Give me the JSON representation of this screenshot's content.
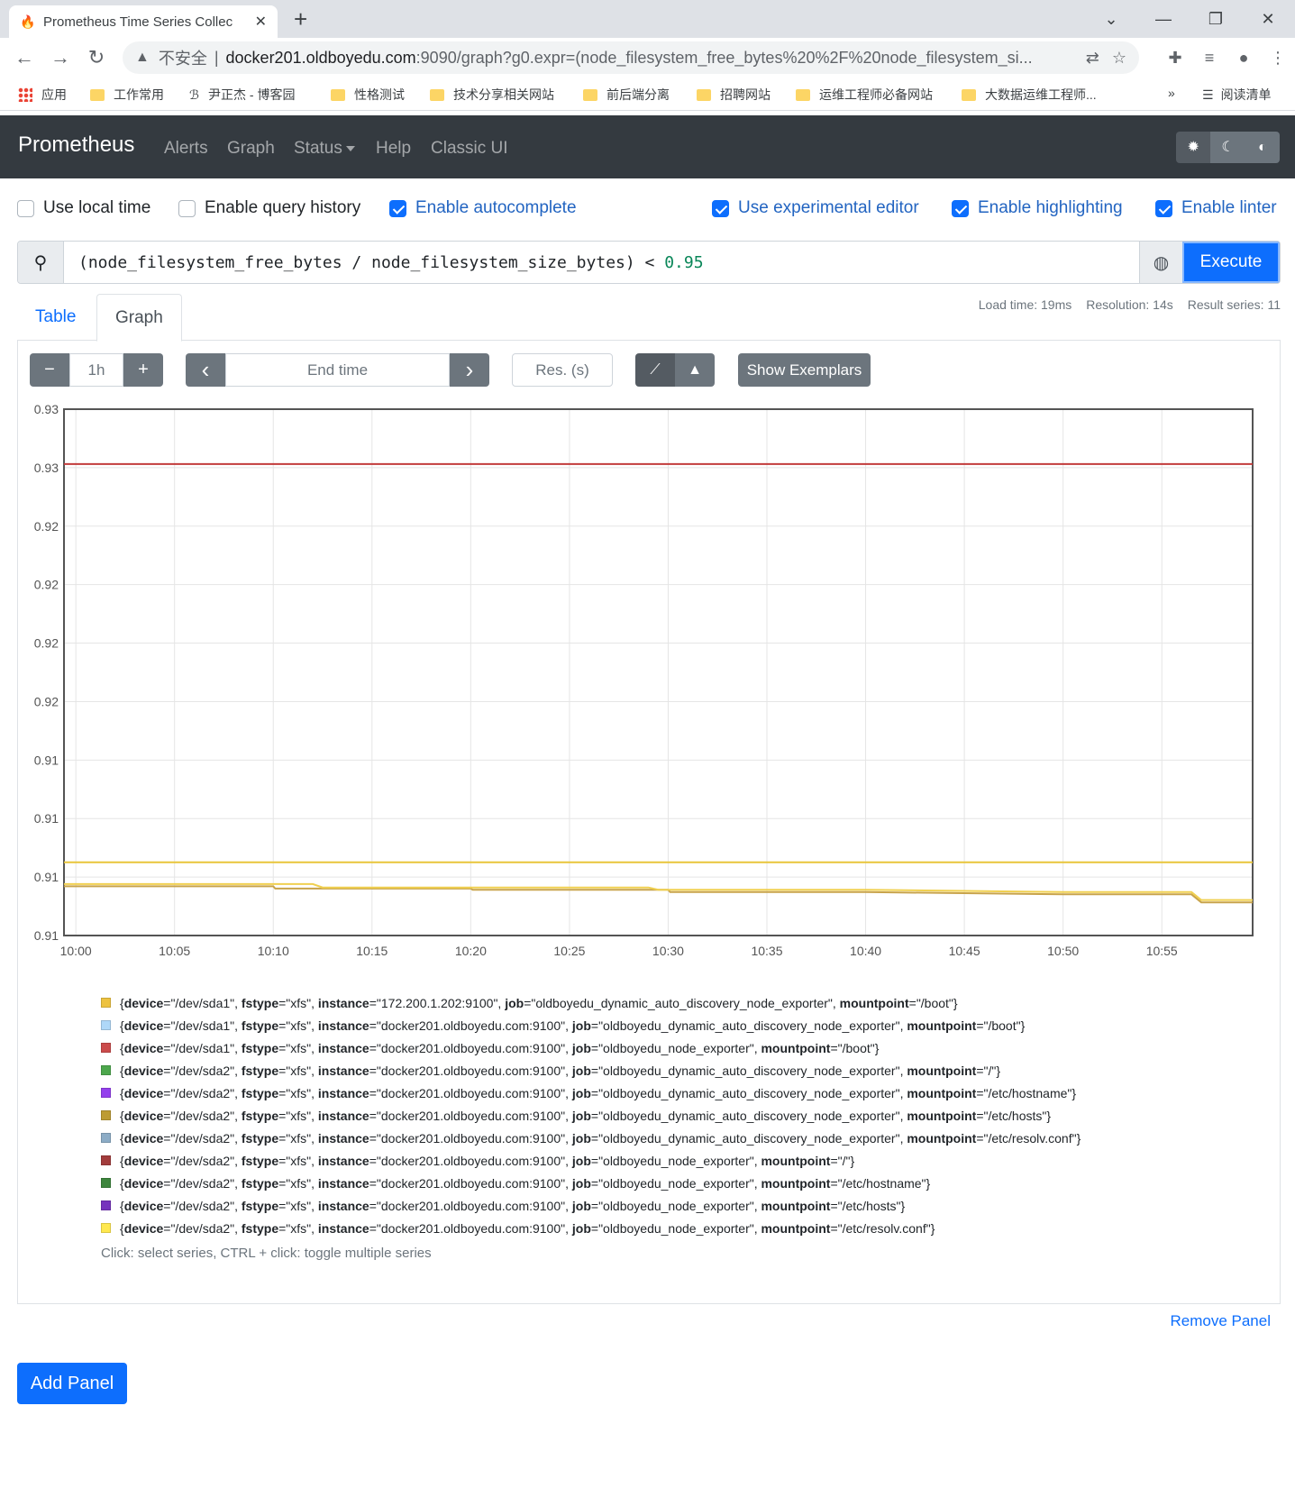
{
  "browser": {
    "tab_title": "Prometheus Time Series Collec",
    "url_insecure": "不安全",
    "url_host": "docker201.oldboyedu.com",
    "url_path": ":9090/graph?g0.expr=(node_filesystem_free_bytes%20%2F%20node_filesystem_si...",
    "bookmarks": [
      "应用",
      "工作常用",
      "尹正杰 - 博客园",
      "性格测试",
      "技术分享相关网站",
      "前后端分离",
      "招聘网站",
      "运维工程师必备网站",
      "大数据运维工程师...",
      "»",
      "阅读清单"
    ]
  },
  "nav": {
    "brand": "Prometheus",
    "links": [
      "Alerts",
      "Graph",
      "Status",
      "Help",
      "Classic UI"
    ]
  },
  "options": [
    {
      "label": "Use local time",
      "checked": false
    },
    {
      "label": "Enable query history",
      "checked": false
    },
    {
      "label": "Enable autocomplete",
      "checked": true
    },
    {
      "label": "Use experimental editor",
      "checked": true
    },
    {
      "label": "Enable highlighting",
      "checked": true
    },
    {
      "label": "Enable linter",
      "checked": true
    }
  ],
  "query": {
    "expr_main": "(node_filesystem_free_bytes / node_filesystem_size_bytes) < ",
    "expr_num": "0.95",
    "execute_label": "Execute"
  },
  "tabs": {
    "table": "Table",
    "graph": "Graph"
  },
  "meta": {
    "load_time": "Load time: 19ms",
    "resolution": "Resolution: 14s",
    "result_series": "Result series: 11"
  },
  "controls": {
    "minus": "−",
    "range": "1h",
    "plus": "+",
    "prev": "‹",
    "end_time_placeholder": "End time",
    "next": "›",
    "res_placeholder": "Res. (s)",
    "exemplars": "Show Exemplars"
  },
  "chart_data": {
    "type": "line",
    "ylim": [
      0.9095,
      0.9325
    ],
    "yticks": [
      "0.93",
      "0.93",
      "0.92",
      "0.92",
      "0.92",
      "0.92",
      "0.91",
      "0.91",
      "0.91",
      "0.91"
    ],
    "xticks": [
      "10:00",
      "10:05",
      "10:10",
      "10:15",
      "10:20",
      "10:25",
      "10:30",
      "10:35",
      "10:40",
      "10:45",
      "10:50",
      "10:55"
    ],
    "x_minutes": [
      0,
      5,
      10,
      15,
      20,
      25,
      30,
      35,
      40,
      45,
      50,
      55
    ],
    "x_range_minutes": [
      -0.6,
      59.6
    ],
    "grid": true,
    "series": [
      {
        "color": "#c23b3b",
        "points": [
          [
            -0.6,
            0.9301
          ],
          [
            59.6,
            0.9301
          ]
        ]
      },
      {
        "color": "#e8c53a",
        "points": [
          [
            -0.6,
            0.9127
          ],
          [
            59.6,
            0.9127
          ]
        ]
      },
      {
        "color": "#c8a34a",
        "points": [
          [
            -0.6,
            0.91165
          ],
          [
            10,
            0.91165
          ],
          [
            10.1,
            0.91155
          ],
          [
            20,
            0.91155
          ],
          [
            20.1,
            0.9115
          ],
          [
            30,
            0.9115
          ],
          [
            30.1,
            0.9114
          ],
          [
            40,
            0.9114
          ],
          [
            50,
            0.9113
          ],
          [
            56.5,
            0.9113
          ],
          [
            57,
            0.91095
          ],
          [
            59.6,
            0.91095
          ]
        ]
      },
      {
        "color": "#f0d050",
        "points": [
          [
            -0.6,
            0.91175
          ],
          [
            12,
            0.91175
          ],
          [
            12.5,
            0.9116
          ],
          [
            25,
            0.9116
          ],
          [
            29,
            0.9116
          ],
          [
            29.5,
            0.9115
          ],
          [
            40,
            0.9115
          ],
          [
            50,
            0.9114
          ],
          [
            56.5,
            0.9114
          ],
          [
            57,
            0.91105
          ],
          [
            59.6,
            0.91105
          ]
        ]
      }
    ]
  },
  "legend": [
    {
      "color": "#edc240",
      "device": "\"/dev/sda1\"",
      "fstype": "\"xfs\"",
      "instance": "\"172.200.1.202:9100\"",
      "job": "\"oldboyedu_dynamic_auto_discovery_node_exporter\"",
      "mountpoint": "\"/boot\""
    },
    {
      "color": "#afd8f8",
      "device": "\"/dev/sda1\"",
      "fstype": "\"xfs\"",
      "instance": "\"docker201.oldboyedu.com:9100\"",
      "job": "\"oldboyedu_dynamic_auto_discovery_node_exporter\"",
      "mountpoint": "\"/boot\""
    },
    {
      "color": "#cb4b4b",
      "device": "\"/dev/sda1\"",
      "fstype": "\"xfs\"",
      "instance": "\"docker201.oldboyedu.com:9100\"",
      "job": "\"oldboyedu_node_exporter\"",
      "mountpoint": "\"/boot\""
    },
    {
      "color": "#4da74d",
      "device": "\"/dev/sda2\"",
      "fstype": "\"xfs\"",
      "instance": "\"docker201.oldboyedu.com:9100\"",
      "job": "\"oldboyedu_dynamic_auto_discovery_node_exporter\"",
      "mountpoint": "\"/\""
    },
    {
      "color": "#9440ed",
      "device": "\"/dev/sda2\"",
      "fstype": "\"xfs\"",
      "instance": "\"docker201.oldboyedu.com:9100\"",
      "job": "\"oldboyedu_dynamic_auto_discovery_node_exporter\"",
      "mountpoint": "\"/etc/hostname\""
    },
    {
      "color": "#bd9b33",
      "device": "\"/dev/sda2\"",
      "fstype": "\"xfs\"",
      "instance": "\"docker201.oldboyedu.com:9100\"",
      "job": "\"oldboyedu_dynamic_auto_discovery_node_exporter\"",
      "mountpoint": "\"/etc/hosts\""
    },
    {
      "color": "#8cacc6",
      "device": "\"/dev/sda2\"",
      "fstype": "\"xfs\"",
      "instance": "\"docker201.oldboyedu.com:9100\"",
      "job": "\"oldboyedu_dynamic_auto_discovery_node_exporter\"",
      "mountpoint": "\"/etc/resolv.conf\""
    },
    {
      "color": "#a23c3c",
      "device": "\"/dev/sda2\"",
      "fstype": "\"xfs\"",
      "instance": "\"docker201.oldboyedu.com:9100\"",
      "job": "\"oldboyedu_node_exporter\"",
      "mountpoint": "\"/\""
    },
    {
      "color": "#3d853d",
      "device": "\"/dev/sda2\"",
      "fstype": "\"xfs\"",
      "instance": "\"docker201.oldboyedu.com:9100\"",
      "job": "\"oldboyedu_node_exporter\"",
      "mountpoint": "\"/etc/hostname\""
    },
    {
      "color": "#7633bd",
      "device": "\"/dev/sda2\"",
      "fstype": "\"xfs\"",
      "instance": "\"docker201.oldboyedu.com:9100\"",
      "job": "\"oldboyedu_node_exporter\"",
      "mountpoint": "\"/etc/hosts\""
    },
    {
      "color": "#ffe84f",
      "device": "\"/dev/sda2\"",
      "fstype": "\"xfs\"",
      "instance": "\"docker201.oldboyedu.com:9100\"",
      "job": "\"oldboyedu_node_exporter\"",
      "mountpoint": "\"/etc/resolv.conf\""
    }
  ],
  "hint": "Click: select series, CTRL + click: toggle multiple series",
  "remove_panel": "Remove Panel",
  "add_panel": "Add Panel"
}
